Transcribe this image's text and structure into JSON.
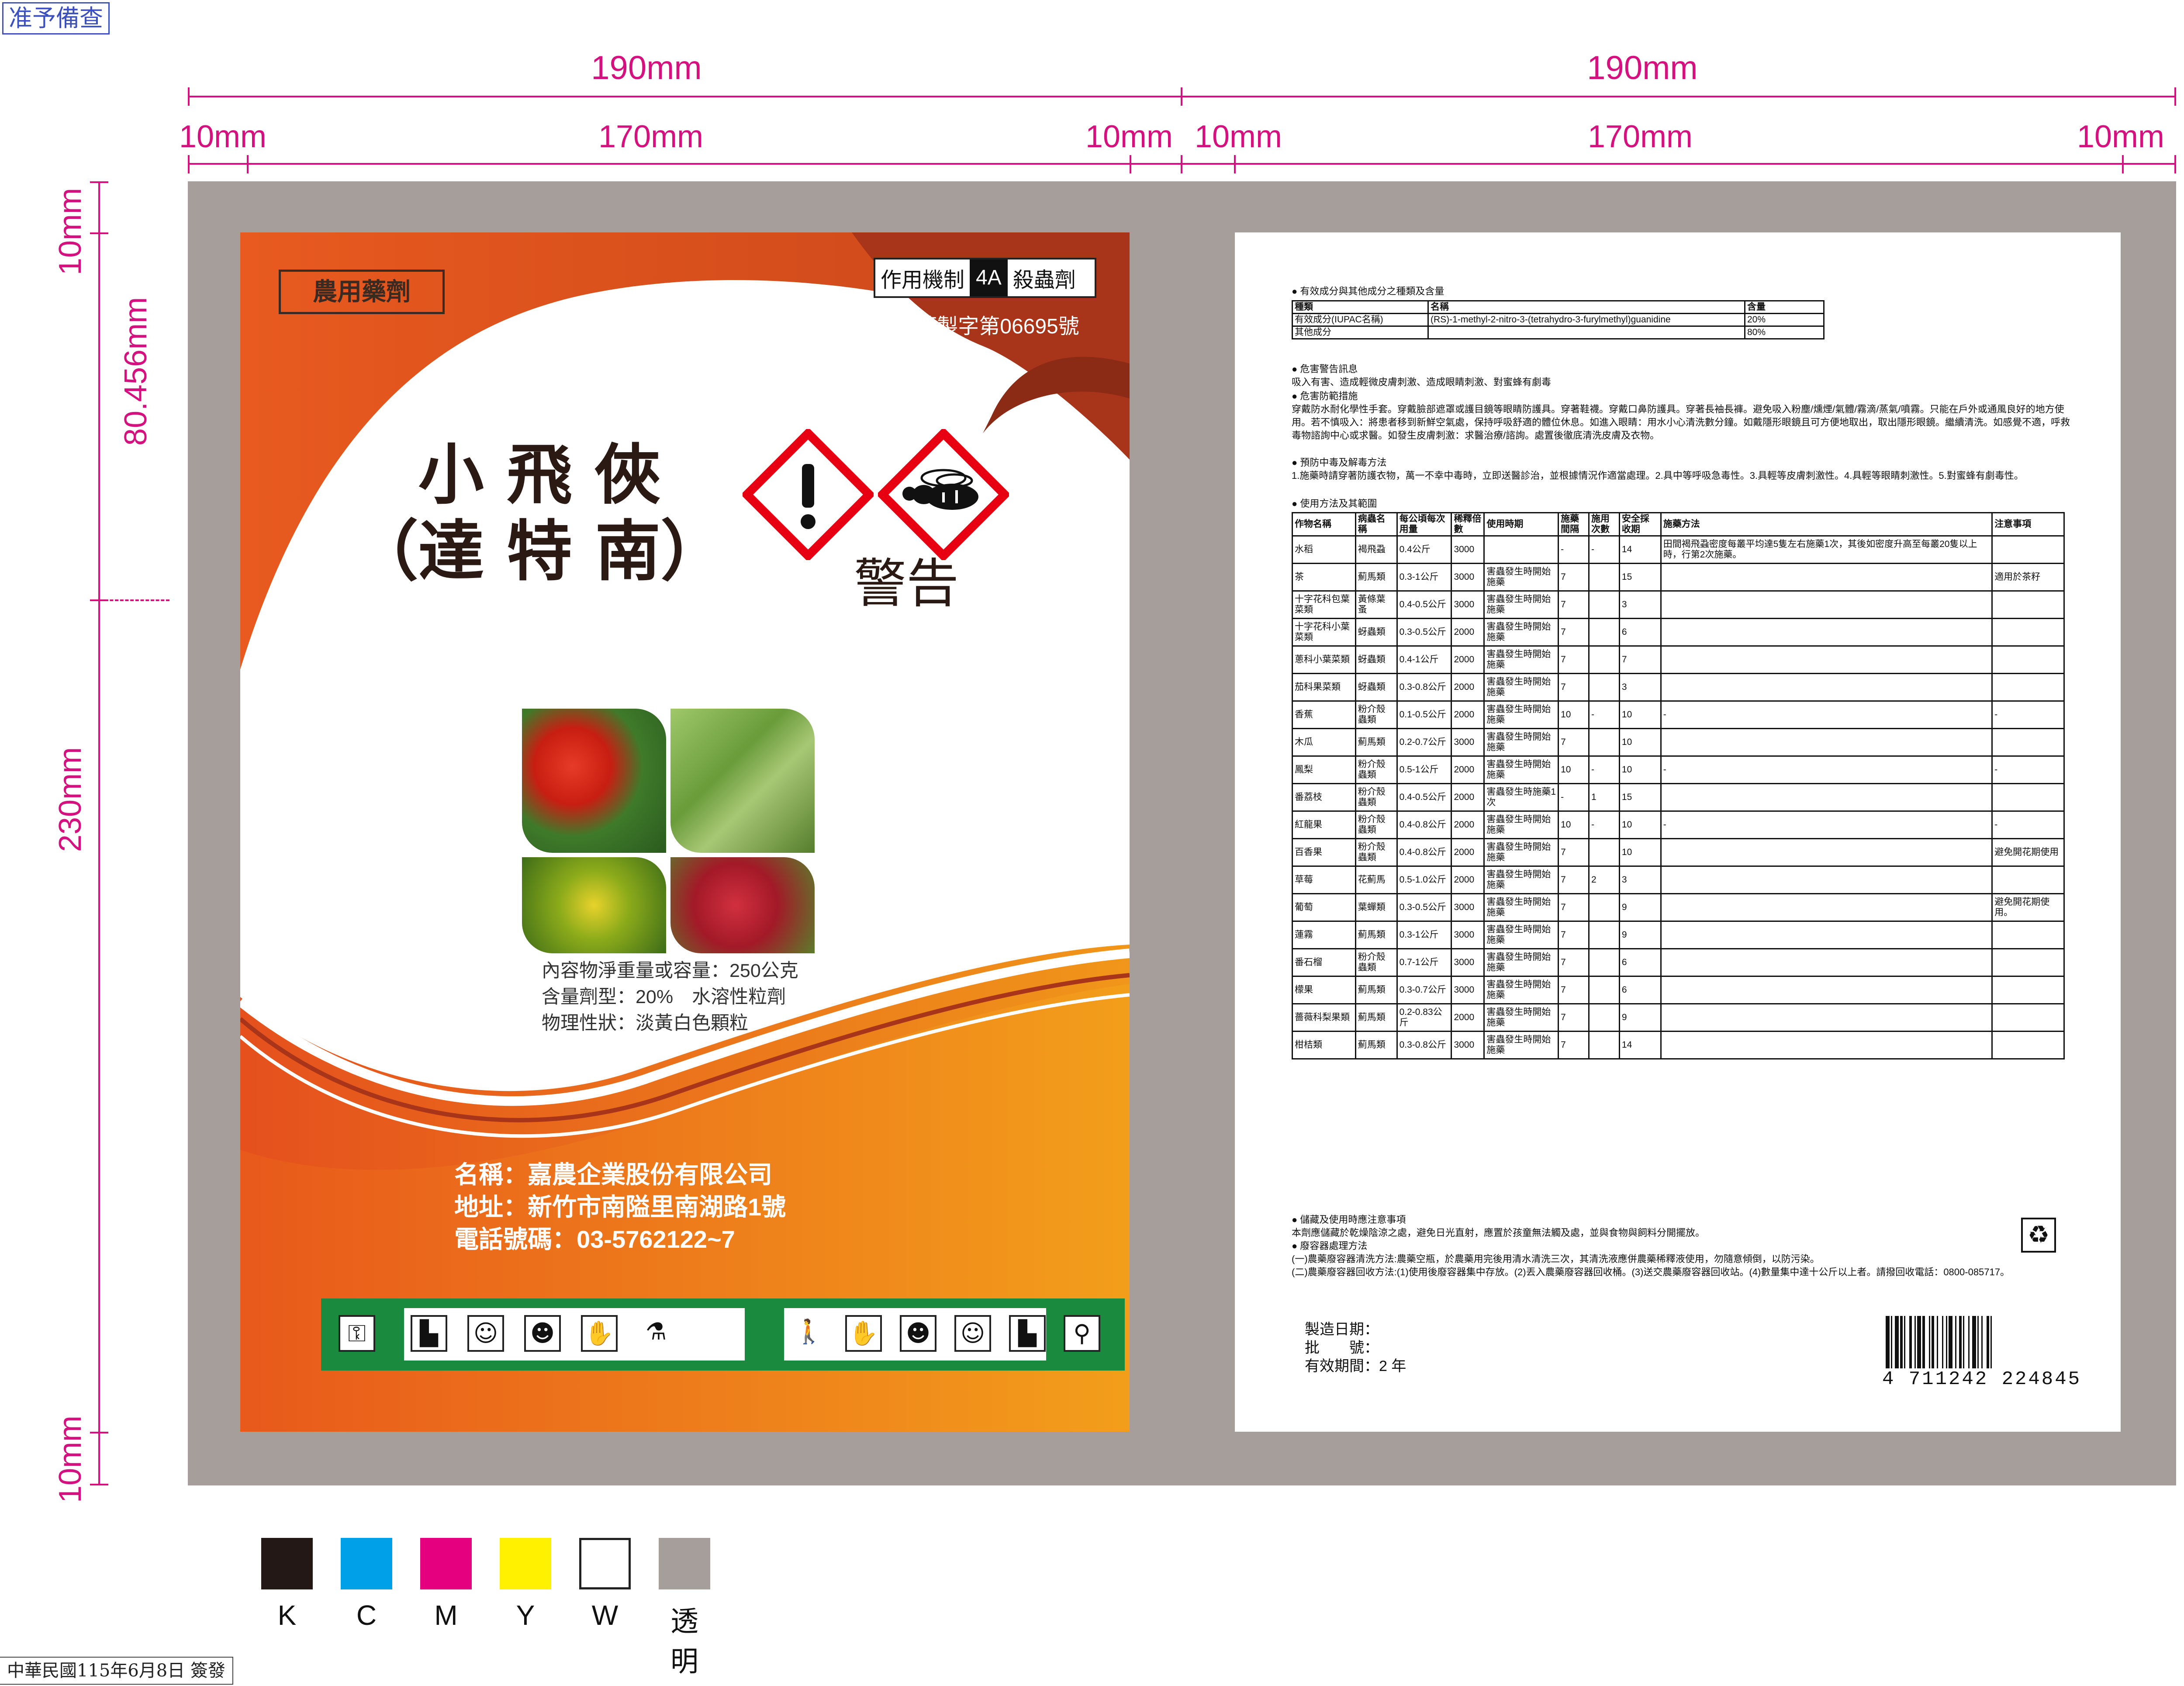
{
  "stamps": {
    "approval": "准予備查",
    "issue_date": "中華民國115年6月8日 簽發"
  },
  "dimensions": {
    "top_total_left": "190mm",
    "top_total_right": "190mm",
    "top_parts_left": [
      "10mm",
      "170mm",
      "10mm"
    ],
    "top_parts_right": [
      "10mm",
      "170mm",
      "10mm"
    ],
    "left_side": [
      "10mm",
      "80.456mm",
      "230mm",
      "10mm"
    ]
  },
  "front": {
    "category": "農用藥劑",
    "moa_label": "作用機制",
    "moa_code": "4A",
    "moa_type": "殺蟲劑",
    "registration": "農藥製字第06695號",
    "brand_line1": "小 飛 俠",
    "brand_line2": "（達 特 南）",
    "warning_word": "警告",
    "content_lines": [
      "內容物淨重量或容量：250公克",
      "含量劑型：20%　水溶性粒劑",
      "物理性狀：淡黃白色顆粒"
    ],
    "company_lines": [
      "名稱：嘉農企業股份有限公司",
      "地址：新竹市南隘里南湖路1號",
      "電話號碼：03-5762122~7"
    ],
    "pictograms": [
      "storage-icon",
      "boots-icon",
      "mask-icon",
      "face-shield-icon",
      "gloves-icon",
      "measure-icon",
      "spray-icon",
      "gloves-icon",
      "face-shield-icon",
      "mask-icon",
      "boots-icon",
      "wash-icon"
    ]
  },
  "back": {
    "sec1_title": "有效成分與其他成分之種類及含量",
    "ingredients": {
      "headers": [
        "種類",
        "名稱",
        "含量"
      ],
      "rows": [
        [
          "有效成分(IUPAC名稱)",
          "(RS)-1-methyl-2-nitro-3-(tetrahydro-3-furylmethyl)guanidine",
          "20%"
        ],
        [
          "其他成分",
          "",
          "80%"
        ]
      ]
    },
    "sec2_title": "危害警告訊息",
    "sec2_text": "吸入有害、造成輕微皮膚刺激、造成眼睛刺激、對蜜蜂有劇毒",
    "sec3_title": "危害防範措施",
    "sec3_text": "穿戴防水耐化學性手套。穿戴臉部遮罩或護目鏡等眼睛防護具。穿著鞋襪。穿戴口鼻防護具。穿著長袖長褲。避免吸入粉塵/燻煙/氣體/霧滴/蒸氣/噴霧。只能在戶外或通風良好的地方使用。若不慎吸入：將患者移到新鮮空氣處，保持呼吸舒適的體位休息。如進入眼睛：用水小心清洗數分鐘。如戴隱形眼鏡且可方便地取出，取出隱形眼鏡。繼續清洗。如感覺不適，呼救毒物諮詢中心或求醫。如發生皮膚刺激：求醫治療/諮詢。處置後徹底清洗皮膚及衣物。",
    "sec4_title": "預防中毒及解毒方法",
    "sec4_text": "1.施藥時請穿著防護衣物，萬一不幸中毒時，立即送醫診治，並根據情況作適當處理。2.具中等呼吸急毒性。3.具輕等皮膚刺激性。4.具輕等眼睛刺激性。5.對蜜蜂有劇毒性。",
    "sec5_title": "使用方法及其範圍",
    "usage": {
      "headers": [
        "作物名稱",
        "病蟲名稱",
        "每公頃每次用量",
        "稀釋倍數",
        "使用時期",
        "施藥間隔",
        "施用次數",
        "安全採收期",
        "施藥方法",
        "注意事項"
      ],
      "rows": [
        [
          "水稻",
          "褐飛蝨",
          "0.4公斤",
          "3000",
          "",
          "-",
          "-",
          "14",
          "田間褐飛蝨密度每叢平均達5隻左右施藥1次，其後如密度升高至每叢20隻以上時，行第2次施藥。",
          ""
        ],
        [
          "茶",
          "薊馬類",
          "0.3-1公斤",
          "3000",
          "害蟲發生時開始施藥",
          "7",
          "",
          "15",
          "",
          "適用於茶籽"
        ],
        [
          "十字花科包葉菜類",
          "黃條葉蚤",
          "0.4-0.5公斤",
          "3000",
          "害蟲發生時開始施藥",
          "7",
          "",
          "3",
          "",
          ""
        ],
        [
          "十字花科小葉菜類",
          "蚜蟲類",
          "0.3-0.5公斤",
          "2000",
          "害蟲發生時開始施藥",
          "7",
          "",
          "6",
          "",
          ""
        ],
        [
          "蔥科小葉菜類",
          "蚜蟲類",
          "0.4-1公斤",
          "2000",
          "害蟲發生時開始施藥",
          "7",
          "",
          "7",
          "",
          ""
        ],
        [
          "茄科果菜類",
          "蚜蟲類",
          "0.3-0.8公斤",
          "2000",
          "害蟲發生時開始施藥",
          "7",
          "",
          "3",
          "",
          ""
        ],
        [
          "香蕉",
          "粉介殼蟲類",
          "0.1-0.5公斤",
          "2000",
          "害蟲發生時開始施藥",
          "10",
          "-",
          "10",
          "-",
          "-"
        ],
        [
          "木瓜",
          "薊馬類",
          "0.2-0.7公斤",
          "3000",
          "害蟲發生時開始施藥",
          "7",
          "",
          "10",
          "",
          ""
        ],
        [
          "鳳梨",
          "粉介殼蟲類",
          "0.5-1公斤",
          "2000",
          "害蟲發生時開始施藥",
          "10",
          "-",
          "10",
          "-",
          "-"
        ],
        [
          "番荔枝",
          "粉介殼蟲類",
          "0.4-0.5公斤",
          "2000",
          "害蟲發生時施藥1次",
          "-",
          "1",
          "15",
          "",
          ""
        ],
        [
          "紅龍果",
          "粉介殼蟲類",
          "0.4-0.8公斤",
          "2000",
          "害蟲發生時開始施藥",
          "10",
          "-",
          "10",
          "-",
          "-"
        ],
        [
          "百香果",
          "粉介殼蟲類",
          "0.4-0.8公斤",
          "2000",
          "害蟲發生時開始施藥",
          "7",
          "",
          "10",
          "",
          "避免開花期使用"
        ],
        [
          "草莓",
          "花薊馬",
          "0.5-1.0公斤",
          "2000",
          "害蟲發生時開始施藥",
          "7",
          "2",
          "3",
          "",
          ""
        ],
        [
          "葡萄",
          "葉蟬類",
          "0.3-0.5公斤",
          "3000",
          "害蟲發生時開始施藥",
          "7",
          "",
          "9",
          "",
          "避免開花期使用。"
        ],
        [
          "蓮霧",
          "薊馬類",
          "0.3-1公斤",
          "3000",
          "害蟲發生時開始施藥",
          "7",
          "",
          "9",
          "",
          ""
        ],
        [
          "番石榴",
          "粉介殼蟲類",
          "0.7-1公斤",
          "3000",
          "害蟲發生時開始施藥",
          "7",
          "",
          "6",
          "",
          ""
        ],
        [
          "檬果",
          "薊馬類",
          "0.3-0.7公斤",
          "3000",
          "害蟲發生時開始施藥",
          "7",
          "",
          "6",
          "",
          ""
        ],
        [
          "薔薇科梨果類",
          "薊馬類",
          "0.2-0.83公斤",
          "2000",
          "害蟲發生時開始施藥",
          "7",
          "",
          "9",
          "",
          ""
        ],
        [
          "柑桔類",
          "薊馬類",
          "0.3-0.8公斤",
          "3000",
          "害蟲發生時開始施藥",
          "7",
          "",
          "14",
          "",
          ""
        ]
      ]
    },
    "sec6_title": "儲藏及使用時應注意事項",
    "sec6_text": "本劑應儲藏於乾燥陰涼之處，避免日光直射，應置於孩童無法觸及處，並與食物與飼料分開擺放。",
    "sec7_title": "廢容器處理方法",
    "sec7_lines": [
      "(一)農藥廢容器清洗方法:農藥空瓶，於農藥用完後用清水清洗三次，其清洗液應併農藥稀釋液使用，勿隨意傾倒，以防污染。",
      "(二)農藥廢容器回收方法:(1)使用後廢容器集中存放。(2)丟入農藥廢容器回收桶。(3)送交農藥廢容器回收站。(4)數量集中達十公斤以上者。請撥回收電話：0800-085717。"
    ],
    "mfg_label": "製造日期：",
    "batch_label": "批　　號：",
    "expiry_label": "有效期間：",
    "expiry_value": "2 年",
    "barcode_number": "4 711242 224845"
  },
  "swatches": [
    {
      "label": "K",
      "color": "#231815"
    },
    {
      "label": "C",
      "color": "#00a0e9"
    },
    {
      "label": "M",
      "color": "#e4007f"
    },
    {
      "label": "Y",
      "color": "#fff100"
    },
    {
      "label": "W",
      "color": "#ffffff"
    },
    {
      "label": "透明",
      "color": "#a59e9a"
    }
  ],
  "colors": {
    "magenta_dim": "#d4117e",
    "orange": "#e8571c",
    "green_bar": "#1a8a3e",
    "gray_bg": "#a59e9a"
  }
}
